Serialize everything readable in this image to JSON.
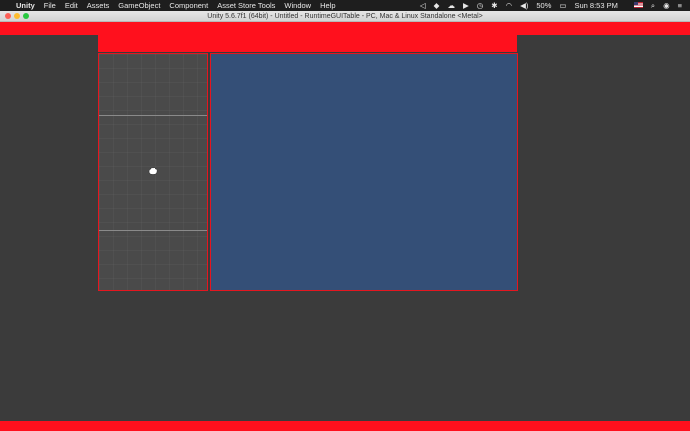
{
  "menubar": {
    "app_name": "Unity",
    "items": [
      "File",
      "Edit",
      "Assets",
      "GameObject",
      "Component",
      "Asset Store Tools",
      "Window",
      "Help"
    ],
    "battery": "50%",
    "clock": "Sun 8:53 PM"
  },
  "window": {
    "title": "Unity 5.6.7f1 (64bit) - Untitled - RuntimeGUITable - PC, Mac & Linux Standalone <Metal>"
  },
  "colors": {
    "accent_red": "#ff101d",
    "panel_blue": "#344f77",
    "panel_gray": "#4a4a4a",
    "background": "#3b3b3b"
  }
}
